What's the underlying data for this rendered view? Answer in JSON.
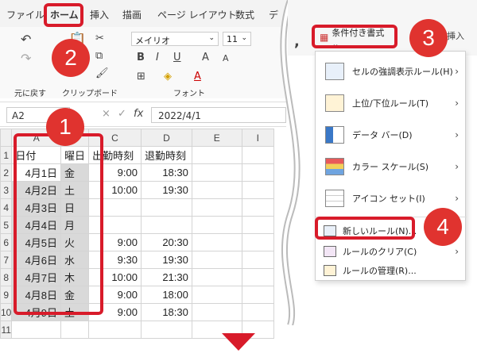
{
  "ribbon": {
    "tabs": [
      "ファイル",
      "ホーム",
      "挿入",
      "描画",
      "ページ レイアウト",
      "数式",
      "デ"
    ],
    "tab_right": "挿入",
    "groups": [
      "元に戻す",
      "クリップボード",
      "フォント"
    ],
    "font_name": "メイリオ",
    "font_size": "11",
    "bold": "B",
    "italic": "I",
    "underline": "U",
    "font_grow": "A",
    "font_shrink": "A",
    "cond_format_button": "条件付き書式 ⌄"
  },
  "formula_bar": {
    "cell_ref": "A2",
    "cancel": "×",
    "enter": "✓",
    "fx": "fx",
    "value": "2022/4/1"
  },
  "sheet": {
    "columns": [
      "A",
      "B",
      "C",
      "D",
      "E",
      "I"
    ],
    "header_row": [
      "日付",
      "曜日",
      "出勤時刻",
      "退勤時刻"
    ],
    "rows": [
      {
        "num": "1"
      },
      {
        "num": "2",
        "date": "4月1日",
        "dow": "金",
        "in": "9:00",
        "out": "18:30"
      },
      {
        "num": "3",
        "date": "4月2日",
        "dow": "土",
        "in": "10:00",
        "out": "19:30"
      },
      {
        "num": "4",
        "date": "4月3日",
        "dow": "日",
        "in": "",
        "out": ""
      },
      {
        "num": "5",
        "date": "4月4日",
        "dow": "月",
        "in": "",
        "out": ""
      },
      {
        "num": "6",
        "date": "4月5日",
        "dow": "火",
        "in": "9:00",
        "out": "20:30"
      },
      {
        "num": "7",
        "date": "4月6日",
        "dow": "水",
        "in": "9:30",
        "out": "19:30"
      },
      {
        "num": "8",
        "date": "4月7日",
        "dow": "木",
        "in": "10:00",
        "out": "21:30"
      },
      {
        "num": "9",
        "date": "4月8日",
        "dow": "金",
        "in": "9:00",
        "out": "18:00"
      },
      {
        "num": "10",
        "date": "4月9日",
        "dow": "土",
        "in": "9:00",
        "out": "18:30"
      },
      {
        "num": "11"
      }
    ]
  },
  "menu": {
    "items": [
      {
        "label": "セルの強調表示ルール(H)",
        "icon": "highlight-cells-icon",
        "has_sub": true
      },
      {
        "label": "上位/下位ルール(T)",
        "icon": "top-bottom-icon",
        "has_sub": true
      },
      {
        "label": "データ バー(D)",
        "icon": "data-bar-icon",
        "has_sub": true
      },
      {
        "label": "カラー スケール(S)",
        "icon": "color-scale-icon",
        "has_sub": true
      },
      {
        "label": "アイコン セット(I)",
        "icon": "icon-set-icon",
        "has_sub": true
      },
      {
        "label": "新しいルール(N)...",
        "icon": "new-rule-icon",
        "has_sub": false
      },
      {
        "label": "ルールのクリア(C)",
        "icon": "clear-rule-icon",
        "has_sub": true
      },
      {
        "label": "ルールの管理(R)...",
        "icon": "manage-rule-icon",
        "has_sub": false
      }
    ],
    "chevron": "›"
  },
  "steps": [
    "1",
    "2",
    "3",
    "4"
  ],
  "colors": {
    "accent_red": "#d81b2a",
    "badge_red": "#e0332f"
  }
}
